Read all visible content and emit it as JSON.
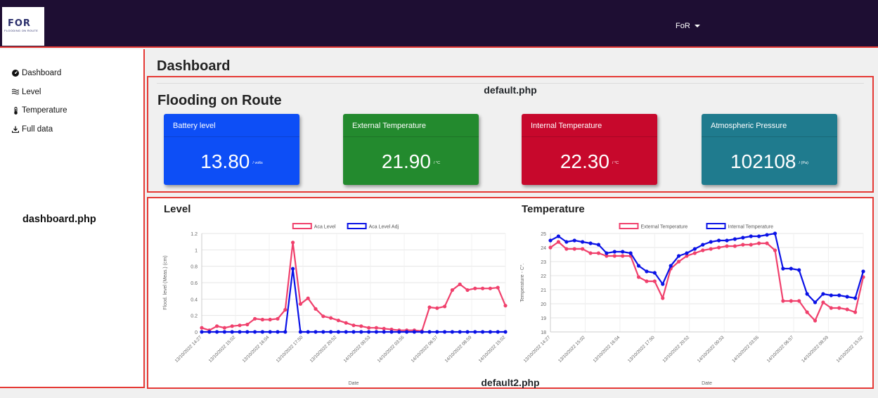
{
  "logo": {
    "mark": "FOR",
    "subtitle": "FLOODING ON ROUTE"
  },
  "header": {
    "user_menu": "FoR"
  },
  "sidebar": {
    "items": [
      {
        "label": "Dashboard",
        "icon": "gauge-icon"
      },
      {
        "label": "Level",
        "icon": "water-icon"
      },
      {
        "label": "Temperature",
        "icon": "thermometer-icon"
      },
      {
        "label": "Full data",
        "icon": "download-icon"
      }
    ],
    "annotation": "dashboard.php"
  },
  "main": {
    "title": "Dashboard",
    "section1": {
      "annotation": "default.php",
      "title": "Flooding on Route",
      "cards": [
        {
          "label": "Battery level",
          "value": "13.80",
          "unit": "/ volts",
          "color": "#0d4ef6"
        },
        {
          "label": "External Temperature",
          "value": "21.90",
          "unit": "/ °C",
          "color": "#238a2e"
        },
        {
          "label": "Internal Temperature",
          "value": "22.30",
          "unit": "/ °C",
          "color": "#c7082c"
        },
        {
          "label": "Atmospheric Pressure",
          "value": "102108",
          "unit": "/ (Pa)",
          "color": "#1f7b8e"
        }
      ]
    },
    "section2": {
      "annotation": "default2.php",
      "level_title": "Level",
      "temperature_title": "Temperature"
    }
  },
  "chart_data": [
    {
      "type": "line",
      "xlabel": "Date",
      "ylabel": "Flood. level (Meas.) (cm)",
      "ylim": [
        0,
        1.2
      ],
      "yticks": [
        0,
        0.2,
        0.4,
        0.6,
        0.8,
        1.0,
        1.2
      ],
      "xticks": [
        "13/10/2022 14:27",
        "13/10/2022 15:02",
        "13/10/2022 16:04",
        "13/10/2022 17:50",
        "13/10/2022 20:52",
        "14/10/2022 00:53",
        "14/10/2022 03:55",
        "14/10/2022 06:57",
        "14/10/2022 08:59",
        "14/10/2022 15:02"
      ],
      "grid": true,
      "legend": "top",
      "series": [
        {
          "name": "Aca Level",
          "color": "#f0406c",
          "values": [
            0.05,
            0.02,
            0.07,
            0.05,
            0.07,
            0.08,
            0.09,
            0.16,
            0.15,
            0.15,
            0.16,
            0.27,
            1.09,
            0.34,
            0.41,
            0.28,
            0.19,
            0.17,
            0.14,
            0.11,
            0.08,
            0.07,
            0.05,
            0.05,
            0.04,
            0.03,
            0.02,
            0.02,
            0.02,
            0.01,
            0.3,
            0.29,
            0.31,
            0.51,
            0.58,
            0.51,
            0.53,
            0.53,
            0.53,
            0.54,
            0.32
          ]
        },
        {
          "name": "Aca Level Adj",
          "color": "#0a12e6",
          "values": [
            0,
            0,
            0,
            0,
            0,
            0,
            0,
            0,
            0,
            0,
            0,
            0,
            0.77,
            0,
            0,
            0,
            0,
            0,
            0,
            0,
            0,
            0,
            0,
            0,
            0,
            0,
            0,
            0,
            0,
            0,
            0,
            0,
            0,
            0,
            0,
            0,
            0,
            0,
            0,
            0,
            0
          ]
        }
      ]
    },
    {
      "type": "line",
      "xlabel": "Date",
      "ylabel": "Temperature - C°.",
      "ylim": [
        18,
        25
      ],
      "yticks": [
        18,
        19,
        20,
        21,
        22,
        23,
        24,
        25
      ],
      "xticks": [
        "13/10/2022 14:27",
        "13/10/2022 15:02",
        "13/10/2022 16:04",
        "13/10/2022 17:50",
        "13/10/2022 20:52",
        "14/10/2022 00:53",
        "14/10/2022 03:55",
        "14/10/2022 06:57",
        "14/10/2022 08:59",
        "14/10/2022 15:02"
      ],
      "grid": true,
      "legend": "top",
      "series": [
        {
          "name": "External Temperature",
          "color": "#f0406c",
          "values": [
            24.0,
            24.4,
            23.9,
            23.9,
            23.9,
            23.6,
            23.6,
            23.4,
            23.4,
            23.4,
            23.4,
            21.9,
            21.6,
            21.6,
            20.4,
            22.5,
            23.0,
            23.4,
            23.6,
            23.8,
            23.9,
            24.0,
            24.1,
            24.1,
            24.2,
            24.2,
            24.3,
            24.3,
            23.8,
            20.2,
            20.2,
            20.2,
            19.4,
            18.8,
            20.1,
            19.7,
            19.7,
            19.6,
            19.4,
            21.9
          ]
        },
        {
          "name": "Internal Temperature",
          "color": "#0a12e6",
          "values": [
            24.5,
            24.8,
            24.4,
            24.5,
            24.4,
            24.3,
            24.2,
            23.6,
            23.7,
            23.7,
            23.6,
            22.7,
            22.3,
            22.2,
            21.4,
            22.7,
            23.4,
            23.6,
            23.9,
            24.2,
            24.4,
            24.5,
            24.5,
            24.6,
            24.7,
            24.8,
            24.8,
            24.9,
            25.0,
            22.5,
            22.5,
            22.4,
            20.7,
            20.1,
            20.7,
            20.6,
            20.6,
            20.5,
            20.4,
            22.3
          ]
        }
      ]
    }
  ]
}
